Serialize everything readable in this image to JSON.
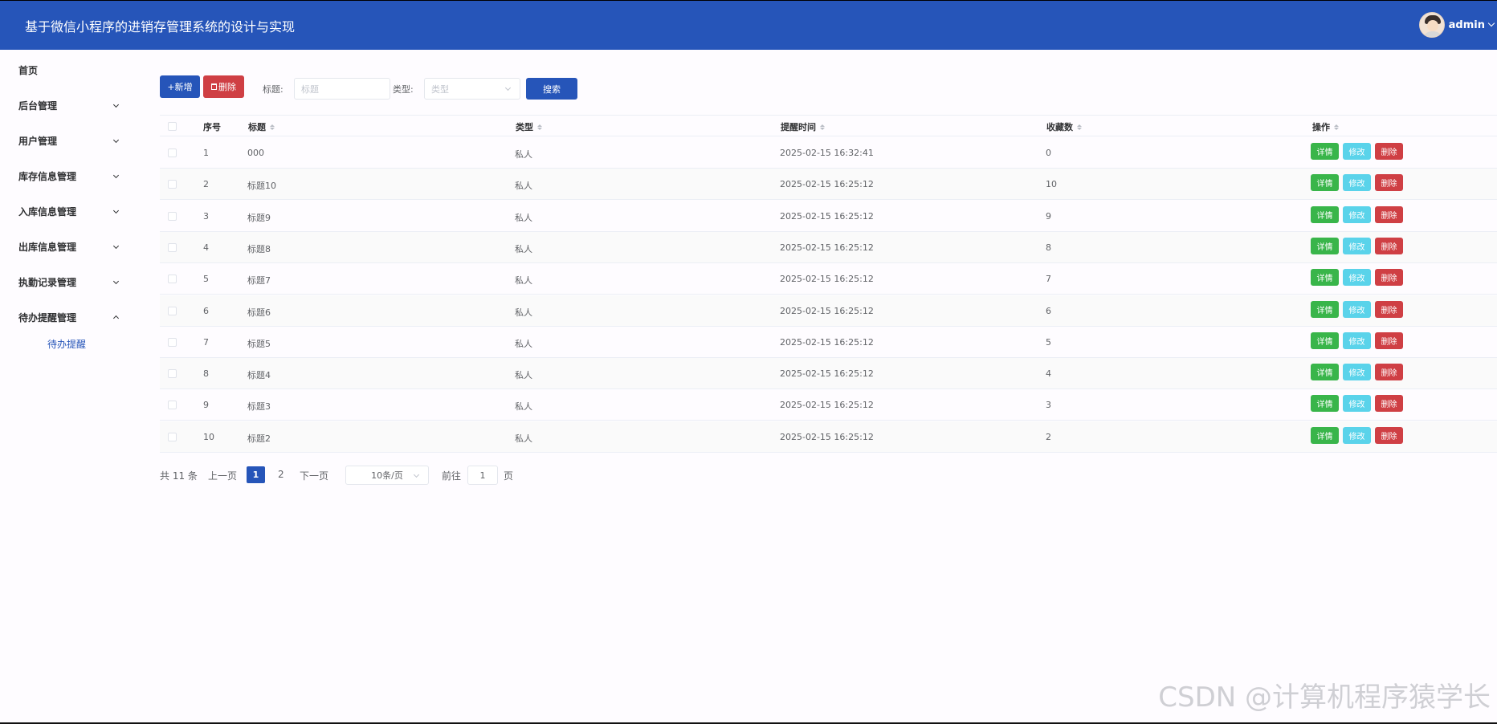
{
  "header": {
    "title": "基于微信小程序的进销存管理系统的设计与实现",
    "username": "admin"
  },
  "sidebar": {
    "home": "首页",
    "items": [
      {
        "label": "后台管理",
        "expanded": false
      },
      {
        "label": "用户管理",
        "expanded": false
      },
      {
        "label": "库存信息管理",
        "expanded": false
      },
      {
        "label": "入库信息管理",
        "expanded": false
      },
      {
        "label": "出库信息管理",
        "expanded": false
      },
      {
        "label": "执勤记录管理",
        "expanded": false
      },
      {
        "label": "待办提醒管理",
        "expanded": true
      }
    ],
    "subitem": "待办提醒"
  },
  "toolbar": {
    "add_label": "+新增",
    "delete_label": "删除",
    "title_label": "标题:",
    "title_placeholder": "标题",
    "type_label": "类型:",
    "type_placeholder": "类型",
    "search_label": "搜索"
  },
  "table": {
    "columns": [
      "序号",
      "标题",
      "类型",
      "提醒时间",
      "收藏数",
      "操作"
    ],
    "rows": [
      {
        "index": "1",
        "title": "000",
        "type": "私人",
        "time": "2025-02-15 16:32:41",
        "favorites": "0"
      },
      {
        "index": "2",
        "title": "标题10",
        "type": "私人",
        "time": "2025-02-15 16:25:12",
        "favorites": "10"
      },
      {
        "index": "3",
        "title": "标题9",
        "type": "私人",
        "time": "2025-02-15 16:25:12",
        "favorites": "9"
      },
      {
        "index": "4",
        "title": "标题8",
        "type": "私人",
        "time": "2025-02-15 16:25:12",
        "favorites": "8"
      },
      {
        "index": "5",
        "title": "标题7",
        "type": "私人",
        "time": "2025-02-15 16:25:12",
        "favorites": "7"
      },
      {
        "index": "6",
        "title": "标题6",
        "type": "私人",
        "time": "2025-02-15 16:25:12",
        "favorites": "6"
      },
      {
        "index": "7",
        "title": "标题5",
        "type": "私人",
        "time": "2025-02-15 16:25:12",
        "favorites": "5"
      },
      {
        "index": "8",
        "title": "标题4",
        "type": "私人",
        "time": "2025-02-15 16:25:12",
        "favorites": "4"
      },
      {
        "index": "9",
        "title": "标题3",
        "type": "私人",
        "time": "2025-02-15 16:25:12",
        "favorites": "3"
      },
      {
        "index": "10",
        "title": "标题2",
        "type": "私人",
        "time": "2025-02-15 16:25:12",
        "favorites": "2"
      }
    ],
    "actions": {
      "detail": "详情",
      "edit": "修改",
      "delete": "删除"
    }
  },
  "pagination": {
    "total": "共 11 条",
    "prev": "上一页",
    "current": "1",
    "page2": "2",
    "next": "下一页",
    "page_size": "10条/页",
    "goto_label": "前往",
    "goto_value": "1",
    "page_suffix": "页"
  },
  "watermark": "CSDN @计算机程序猿学长",
  "colors": {
    "primary": "#2655b9",
    "danger": "#cf3f44",
    "success": "#39b54a",
    "info": "#5ad3ea"
  }
}
